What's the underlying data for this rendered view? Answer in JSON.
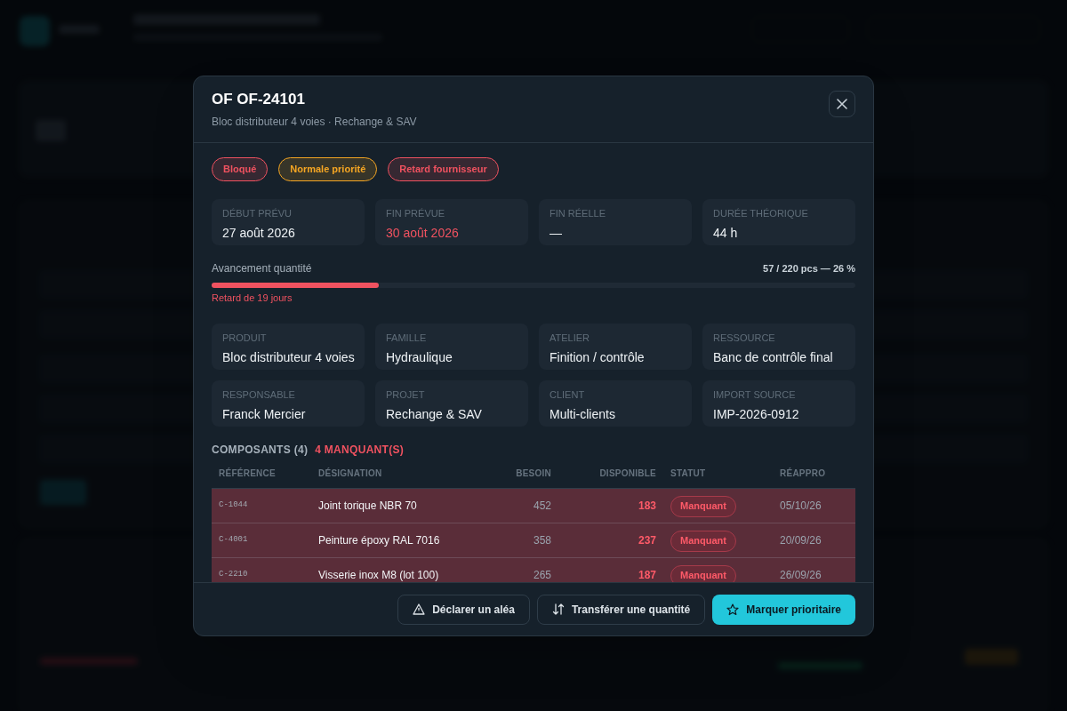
{
  "modal": {
    "title": "OF OF-24101",
    "subtitle": "Bloc distributeur 4 voies · Rechange & SAV",
    "badges": [
      {
        "label": "Bloqué",
        "color": "#f05260"
      },
      {
        "label": "Normale priorité",
        "color": "#f5a623"
      },
      {
        "label": "Retard fournisseur",
        "color": "#f05260"
      }
    ],
    "dates": [
      {
        "label": "DÉBUT PRÉVU",
        "value": "27 août 2026",
        "late": false
      },
      {
        "label": "FIN PRÉVUE",
        "value": "30 août 2026",
        "late": true
      },
      {
        "label": "FIN RÉELLE",
        "value": "—",
        "late": false
      },
      {
        "label": "DURÉE THÉORIQUE",
        "value": "44 h",
        "late": false
      }
    ],
    "progress": {
      "label": "Avancement quantité",
      "reading": "57 / 220 pcs — 26 %",
      "level": 0.26,
      "note": "Retard de 19 jours"
    },
    "details": [
      {
        "label": "PRODUIT",
        "value": "Bloc distributeur 4 voies"
      },
      {
        "label": "FAMILLE",
        "value": "Hydraulique"
      },
      {
        "label": "ATELIER",
        "value": "Finition / contrôle"
      },
      {
        "label": "RESSOURCE",
        "value": "Banc de contrôle final"
      },
      {
        "label": "RESPONSABLE",
        "value": "Franck Mercier"
      },
      {
        "label": "PROJET",
        "value": "Rechange & SAV"
      },
      {
        "label": "CLIENT",
        "value": "Multi-clients"
      },
      {
        "label": "IMPORT SOURCE",
        "value": "IMP-2026-0912"
      }
    ],
    "components": {
      "title": "COMPOSANTS (4)",
      "missing_count": "4 MANQUANT(S)",
      "columns": [
        "RÉFÉRENCE",
        "DÉSIGNATION",
        "BESOIN",
        "DISPONIBLE",
        "STATUT",
        "RÉAPPRO"
      ],
      "rows": [
        {
          "reference": "C-1044",
          "designation": "Joint torique NBR 70",
          "need": "452",
          "available": "183",
          "status": "Manquant",
          "restock": "05/10/26",
          "missing": true
        },
        {
          "reference": "C-4001",
          "designation": "Peinture époxy RAL 7016",
          "need": "358",
          "available": "237",
          "status": "Manquant",
          "restock": "20/09/26",
          "missing": true
        },
        {
          "reference": "C-2210",
          "designation": "Visserie inox M8 (lot 100)",
          "need": "265",
          "available": "187",
          "status": "Manquant",
          "restock": "26/09/26",
          "missing": true
        }
      ]
    },
    "buttons": [
      {
        "label": "Déclarer un aléa",
        "kind": "warning"
      },
      {
        "label": "Transférer une quantité",
        "kind": "transfer"
      },
      {
        "label": "Marquer prioritaire",
        "kind": "star"
      }
    ]
  }
}
